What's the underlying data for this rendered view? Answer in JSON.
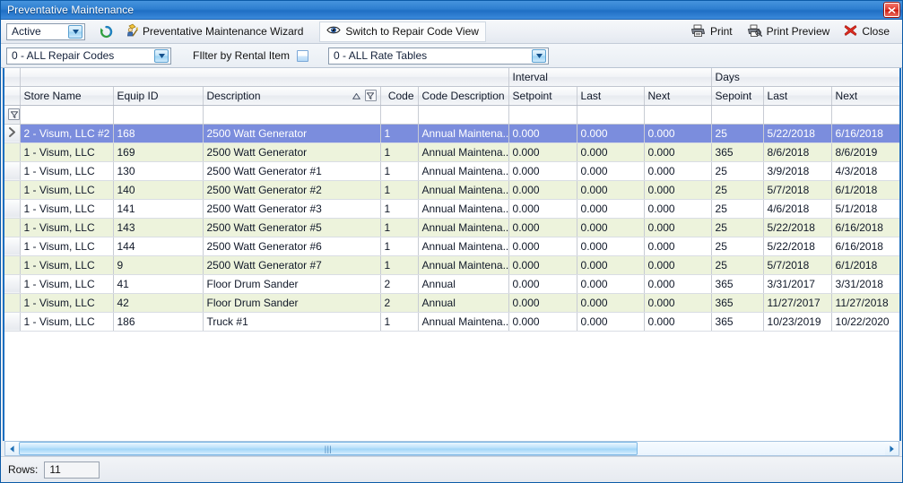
{
  "window": {
    "title": "Preventative Maintenance",
    "close_icon": "close-x-icon"
  },
  "toolbar": {
    "status_filter": {
      "value": "Active",
      "icon": "chevron-down-icon"
    },
    "refresh_icon": "refresh-circular-arrow-icon",
    "wizard_button": {
      "label": "Preventative Maintenance  Wizard",
      "icon": "wizard-hat-wand-icon"
    },
    "switch_view_button": {
      "label": "Switch to Repair Code View",
      "icon": "eye-icon"
    },
    "print_button": {
      "label": "Print",
      "icon": "printer-icon"
    },
    "print_preview_button": {
      "label": "Print Preview",
      "icon": "printer-preview-icon"
    },
    "close_button": {
      "label": "Close",
      "icon": "red-x-icon"
    }
  },
  "filterbar": {
    "repair_codes": {
      "value": "0 - ALL Repair Codes",
      "icon": "chevron-down-icon"
    },
    "rental_item_label": "FIlter by Rental Item",
    "rental_item_checkbox": "checkbox-indeterminate",
    "rate_tables": {
      "value": "0 - ALL Rate Tables",
      "icon": "chevron-down-icon"
    }
  },
  "grid": {
    "group_headers": [
      {
        "label": "",
        "span": 6
      },
      {
        "label": "Interval",
        "span": 3
      },
      {
        "label": "Days",
        "span": 3
      }
    ],
    "columns": [
      {
        "label": "Store Name",
        "align": "left"
      },
      {
        "label": "Equip ID",
        "align": "left"
      },
      {
        "label": "Description",
        "align": "left",
        "sort": "ascending",
        "sort_icon": "sort-asc-triangle-icon",
        "filter_icon": "column-filter-icon"
      },
      {
        "label": "Code",
        "align": "right"
      },
      {
        "label": "Code Description",
        "align": "left"
      },
      {
        "label": "Setpoint",
        "align": "right"
      },
      {
        "label": "Last",
        "align": "right"
      },
      {
        "label": "Next",
        "align": "right"
      },
      {
        "label": "Sepoint",
        "align": "right"
      },
      {
        "label": "Last",
        "align": "left"
      },
      {
        "label": "Next",
        "align": "left"
      }
    ],
    "filter_row_icon": "row-filter-icon",
    "selected_row_indicator": "current-row-arrow-icon",
    "rows": [
      {
        "store": "2 - Visum, LLC #2",
        "equip": "168",
        "desc": "2500 Watt Generator",
        "code": "1",
        "codedesc": "Annual Maintena...",
        "isp": "0.000",
        "ilast": "0.000",
        "inext": "0.000",
        "dsp": "25",
        "dlast": "5/22/2018",
        "dnext": "6/16/2018"
      },
      {
        "store": "1 - Visum, LLC",
        "equip": "169",
        "desc": "2500 Watt Generator",
        "code": "1",
        "codedesc": "Annual Maintena...",
        "isp": "0.000",
        "ilast": "0.000",
        "inext": "0.000",
        "dsp": "365",
        "dlast": "8/6/2018",
        "dnext": "8/6/2019"
      },
      {
        "store": "1 - Visum, LLC",
        "equip": "130",
        "desc": "2500 Watt Generator #1",
        "code": "1",
        "codedesc": "Annual Maintena...",
        "isp": "0.000",
        "ilast": "0.000",
        "inext": "0.000",
        "dsp": "25",
        "dlast": "3/9/2018",
        "dnext": "4/3/2018"
      },
      {
        "store": "1 - Visum, LLC",
        "equip": "140",
        "desc": "2500 Watt Generator #2",
        "code": "1",
        "codedesc": "Annual Maintena...",
        "isp": "0.000",
        "ilast": "0.000",
        "inext": "0.000",
        "dsp": "25",
        "dlast": "5/7/2018",
        "dnext": "6/1/2018"
      },
      {
        "store": "1 - Visum, LLC",
        "equip": "141",
        "desc": "2500 Watt Generator #3",
        "code": "1",
        "codedesc": "Annual Maintena...",
        "isp": "0.000",
        "ilast": "0.000",
        "inext": "0.000",
        "dsp": "25",
        "dlast": "4/6/2018",
        "dnext": "5/1/2018"
      },
      {
        "store": "1 - Visum, LLC",
        "equip": "143",
        "desc": "2500 Watt Generator #5",
        "code": "1",
        "codedesc": "Annual Maintena...",
        "isp": "0.000",
        "ilast": "0.000",
        "inext": "0.000",
        "dsp": "25",
        "dlast": "5/22/2018",
        "dnext": "6/16/2018"
      },
      {
        "store": "1 - Visum, LLC",
        "equip": "144",
        "desc": "2500 Watt Generator #6",
        "code": "1",
        "codedesc": "Annual Maintena...",
        "isp": "0.000",
        "ilast": "0.000",
        "inext": "0.000",
        "dsp": "25",
        "dlast": "5/22/2018",
        "dnext": "6/16/2018"
      },
      {
        "store": "1 - Visum, LLC",
        "equip": "9",
        "desc": "2500 Watt Generator #7",
        "code": "1",
        "codedesc": "Annual Maintena...",
        "isp": "0.000",
        "ilast": "0.000",
        "inext": "0.000",
        "dsp": "25",
        "dlast": "5/7/2018",
        "dnext": "6/1/2018"
      },
      {
        "store": "1 - Visum, LLC",
        "equip": "41",
        "desc": "Floor Drum Sander",
        "code": "2",
        "codedesc": "Annual",
        "isp": "0.000",
        "ilast": "0.000",
        "inext": "0.000",
        "dsp": "365",
        "dlast": "3/31/2017",
        "dnext": "3/31/2018"
      },
      {
        "store": "1 - Visum, LLC",
        "equip": "42",
        "desc": "Floor Drum Sander",
        "code": "2",
        "codedesc": "Annual",
        "isp": "0.000",
        "ilast": "0.000",
        "inext": "0.000",
        "dsp": "365",
        "dlast": "11/27/2017",
        "dnext": "11/27/2018"
      },
      {
        "store": "1 - Visum, LLC",
        "equip": "186",
        "desc": "Truck #1",
        "code": "1",
        "codedesc": "Annual Maintena...",
        "isp": "0.000",
        "ilast": "0.000",
        "inext": "0.000",
        "dsp": "365",
        "dlast": "10/23/2019",
        "dnext": "10/22/2020"
      }
    ]
  },
  "scrollbar": {
    "left_icon": "scroll-left-arrow-icon",
    "right_icon": "scroll-right-arrow-icon",
    "grip_icon": "scroll-grip-icon"
  },
  "statusbar": {
    "rows_label": "Rows:",
    "rows_value": "11"
  },
  "colors": {
    "titlebar": "#2e7fd0",
    "selection": "#7b8ddd",
    "alt_row": "#edf3dc",
    "grid_border": "#1d6fc0",
    "close_red": "#e0362a"
  }
}
